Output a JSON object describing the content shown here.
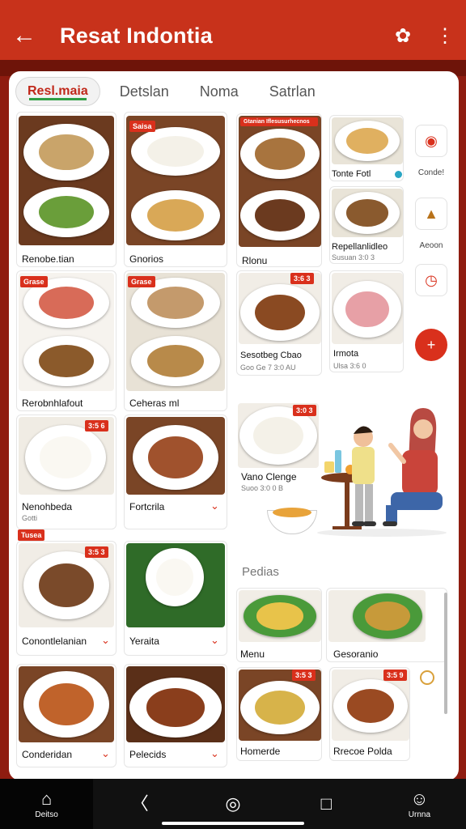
{
  "app": {
    "title": "Resat Indontia",
    "back_icon": "arrow-left-icon",
    "action_icon": "flower-icon",
    "menu_icon": "more-vert-icon"
  },
  "tabs": [
    {
      "label": "Resl.maia",
      "active": true
    },
    {
      "label": "Detslan",
      "active": false
    },
    {
      "label": "Noma",
      "active": false
    },
    {
      "label": "Satrlan",
      "active": false
    }
  ],
  "left_grid": [
    {
      "label": "Renobe.tian",
      "sub": "",
      "badge": ""
    },
    {
      "label": "Gnorios",
      "sub": "",
      "badge": "Saisa"
    },
    {
      "label": "Rerobnhlafout",
      "sub": "",
      "badge": "Grase"
    },
    {
      "label": "Ceheras ml",
      "sub": "",
      "badge": "Grase"
    },
    {
      "label": "Nenohbeda",
      "sub": "Gotti",
      "badge": "3:5 6"
    },
    {
      "label": "Fortcrila",
      "sub": "",
      "badge": ""
    },
    {
      "label": "Conontlelanian",
      "sub": "",
      "badge": "3:5 3"
    },
    {
      "label": "Yeraita",
      "sub": "",
      "badge": ""
    },
    {
      "label": "Conderidan",
      "sub": "",
      "badge": ""
    },
    {
      "label": "Pelecids",
      "sub": "",
      "badge": ""
    }
  ],
  "left_tag": "Tusea",
  "right_grid": [
    {
      "label": "Rlonu",
      "sub": "",
      "badge": "Gtanian Iflesusurhecnos"
    },
    {
      "label": "Tonte Fotl",
      "sub": "",
      "badge": ""
    },
    {
      "label": "Repellanlidleo",
      "sub": "Susuan 3:0 3",
      "badge": ""
    },
    {
      "label": "Sesotbeg Cbao",
      "sub": "Goo Ge 7 3:0 AU",
      "badge": "3:6 3"
    },
    {
      "label": "Irmota",
      "sub": "Ulsa 3:6 0",
      "badge": ""
    },
    {
      "label": "Vano Clenge",
      "sub": "Suoo 3:0 0 B",
      "badge": "3:0 3"
    }
  ],
  "side_icons": [
    {
      "icon": "tomato-icon",
      "label": "Conde!"
    },
    {
      "icon": "spice-icon",
      "label": "Aeoon"
    },
    {
      "icon": "timer-icon",
      "label": ""
    },
    {
      "icon": "add-icon",
      "label": ""
    }
  ],
  "section": {
    "title": "Pedias"
  },
  "pedias": [
    {
      "label": "Menu",
      "badge": ""
    },
    {
      "label": "Gesoranio",
      "badge": ""
    },
    {
      "label": "Homerde",
      "badge": "3:5 3"
    },
    {
      "label": "Rrecoe Polda",
      "badge": "3:5 9"
    }
  ],
  "bottom_nav": [
    {
      "icon": "home-icon",
      "label": "Deitso",
      "active": true
    },
    {
      "icon": "chat-icon",
      "label": "",
      "active": false
    },
    {
      "icon": "record-icon",
      "label": "",
      "active": false
    },
    {
      "icon": "square-icon",
      "label": "",
      "active": false
    },
    {
      "icon": "user-icon",
      "label": "Urnna",
      "active": false
    }
  ],
  "colors": {
    "accent": "#c8321b",
    "dark": "#6e1409",
    "badge": "#d9301c"
  }
}
